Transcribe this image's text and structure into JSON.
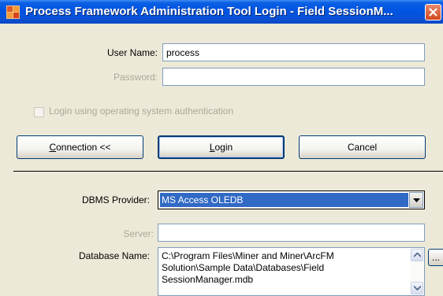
{
  "window": {
    "title": "Process Framework Administration Tool Login - Field SessionM...",
    "app_icon": "app-icon",
    "close_icon": "close-icon"
  },
  "login": {
    "username_label": "User Name:",
    "username_value": "process",
    "password_label": "Password:",
    "password_value": "",
    "os_auth_label": "Login using operating system authentication",
    "os_auth_checked": false
  },
  "buttons": {
    "connection_mnemonic": "C",
    "connection_rest": "onnection <<",
    "login_mnemonic": "L",
    "login_rest": "ogin",
    "cancel": "Cancel"
  },
  "connection": {
    "dbms_label": "DBMS Provider:",
    "dbms_value": "MS Access OLEDB",
    "server_label": "Server:",
    "server_value": "",
    "dbname_label": "Database Name:",
    "dbname_value": "C:\\Program Files\\Miner and Miner\\ArcFM\nSolution\\Sample Data\\Databases\\Field\nSessionManager.mdb",
    "browse_label": "..."
  }
}
